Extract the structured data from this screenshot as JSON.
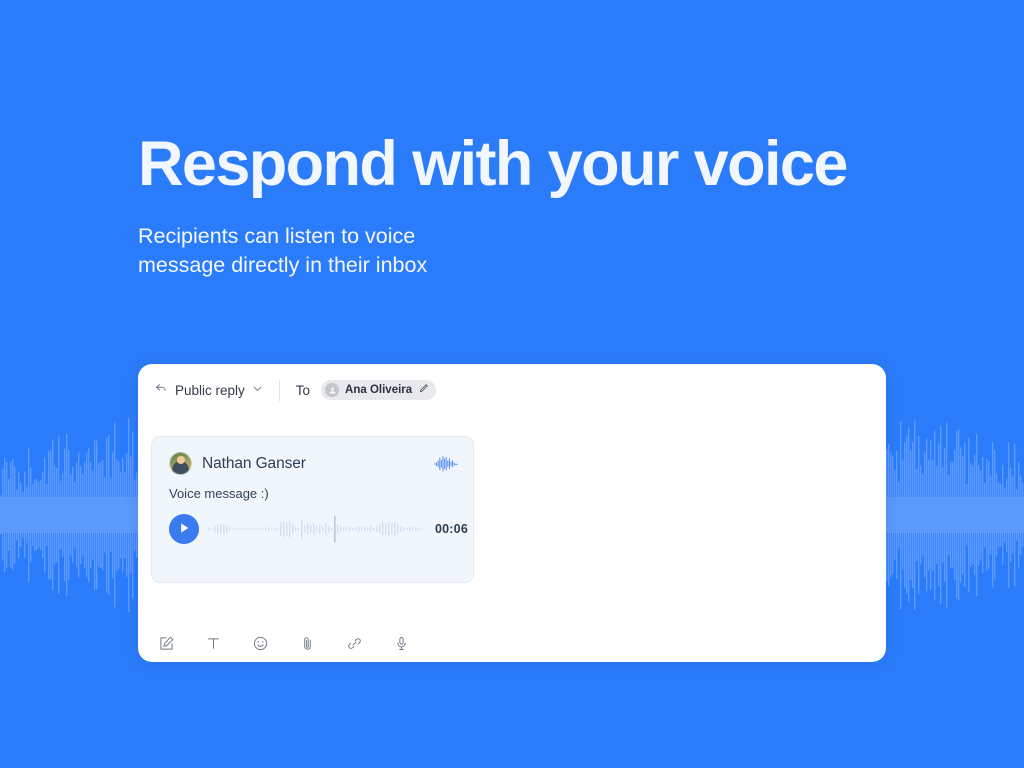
{
  "theme": {
    "background": "#2B7CFB",
    "background_wave": "#5E9BFC",
    "card_background": "#FFFFFF",
    "voice_card_background": "#F1F6FD",
    "accent": "#3A7BF0",
    "text_dark": "#2D3E55",
    "text_light": "#F2F6FE"
  },
  "hero": {
    "title": "Respond with your voice",
    "subtitle": "Recipients can listen to voice message directly in their inbox"
  },
  "composer": {
    "header": {
      "reply_icon": "reply-arrow-icon",
      "reply_mode_label": "Public reply",
      "chevron_icon": "chevron-down-icon",
      "to_label": "To",
      "recipient": {
        "avatar_icon": "person-icon",
        "name": "Ana Oliveira",
        "edit_icon": "pencil-icon"
      }
    },
    "voice_message": {
      "avatar_icon": "user-photo-avatar",
      "sender_name": "Nathan Ganser",
      "waveform_badge_icon": "audio-waveform-icon",
      "body_text": "Voice message :)",
      "play_icon": "play-icon",
      "duration": "00:06",
      "waveform_bars": [
        4,
        2,
        7,
        9,
        11,
        10,
        8,
        3,
        2,
        2,
        2,
        2,
        2,
        2,
        2,
        2,
        2,
        2,
        2,
        3,
        4,
        2,
        3,
        2,
        14,
        16,
        13,
        17,
        11,
        5,
        3,
        20,
        7,
        12,
        9,
        13,
        6,
        10,
        5,
        12,
        7,
        3,
        22,
        9,
        6,
        4,
        3,
        5,
        3,
        4,
        6,
        3,
        5,
        4,
        7,
        3,
        6,
        9,
        13,
        11,
        15,
        12,
        14,
        10,
        6,
        4,
        3,
        5,
        3,
        4,
        3,
        2
      ],
      "cursor_position_index": 42
    },
    "toolbar": [
      {
        "icon": "compose-edit-icon",
        "label": "Compose"
      },
      {
        "icon": "text-format-icon",
        "label": "Text formatting"
      },
      {
        "icon": "emoji-icon",
        "label": "Emoji"
      },
      {
        "icon": "attachment-paperclip-icon",
        "label": "Attach file"
      },
      {
        "icon": "link-icon",
        "label": "Insert link"
      },
      {
        "icon": "microphone-icon",
        "label": "Record voice"
      }
    ]
  }
}
